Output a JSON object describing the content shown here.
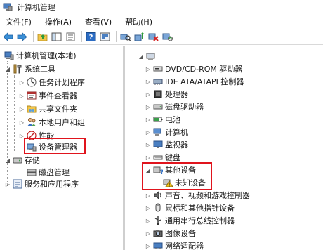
{
  "window": {
    "title": "计算机管理"
  },
  "menu": [
    "文件(F)",
    "操作(A)",
    "查看(V)",
    "帮助(H)"
  ],
  "toolbar_icons": [
    "back-arrow-icon",
    "forward-arrow-icon",
    "up-folder-icon",
    "console-tree-icon",
    "properties-icon",
    "help-icon",
    "view-icon",
    "scan-hardware-icon",
    "update-driver-icon",
    "disable-device-icon",
    "uninstall-device-icon"
  ],
  "left_tree": {
    "root": "计算机管理(本地)",
    "system_tools": "系统工具",
    "task_scheduler": "任务计划程序",
    "event_viewer": "事件查看器",
    "shared_folders": "共享文件夹",
    "local_users": "本地用户和组",
    "performance": "性能",
    "device_manager": "设备管理器",
    "storage": "存储",
    "disk_management": "磁盘管理",
    "services": "服务和应用程序"
  },
  "device_tree": {
    "dvd": "DVD/CD-ROM 驱动器",
    "ide": "IDE ATA/ATAPI 控制器",
    "processor": "处理器",
    "disk_drive": "磁盘驱动器",
    "battery": "电池",
    "computer": "计算机",
    "monitor": "监视器",
    "keyboard": "键盘",
    "other_devices": "其他设备",
    "unknown_device": "未知设备",
    "sound": "声音、视频和游戏控制器",
    "mouse": "鼠标和其他指针设备",
    "usb": "通用串行总线控制器",
    "imaging": "图像设备",
    "network": "网络适配器"
  },
  "colors": {
    "highlight_border": "#e0141d",
    "warning_yellow": "#f2c31a"
  }
}
